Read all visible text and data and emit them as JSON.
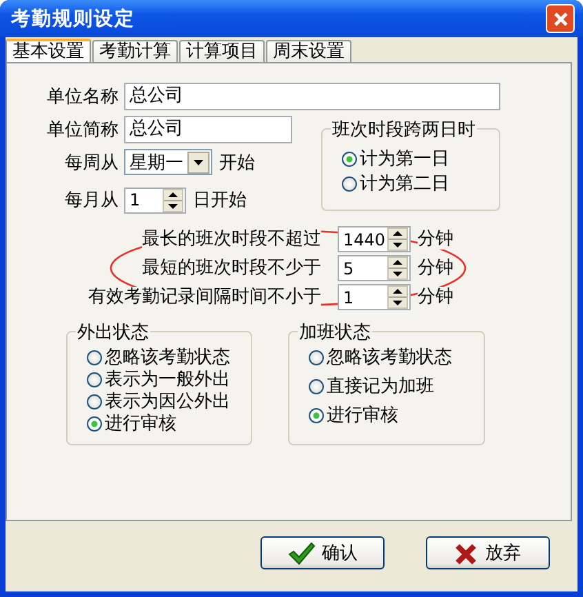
{
  "window": {
    "title": "考勤规则设定"
  },
  "tabs": [
    {
      "label": "基本设置",
      "selected": true
    },
    {
      "label": "考勤计算",
      "selected": false
    },
    {
      "label": "计算项目",
      "selected": false
    },
    {
      "label": "周末设置",
      "selected": false
    }
  ],
  "fields": [
    {
      "label": "单位名称",
      "value": "总公司"
    },
    {
      "label": "单位简称",
      "value": "总公司"
    }
  ],
  "week_start": {
    "label": "每周从",
    "value": "星期一",
    "suffix": "开始"
  },
  "month_start": {
    "label": "每月从",
    "value": "1",
    "suffix": "日开始"
  },
  "cross_day": {
    "title": "班次时段跨两日时",
    "options": [
      {
        "label": "计为第一日",
        "selected": true
      },
      {
        "label": "计为第二日",
        "selected": false
      }
    ]
  },
  "limits": [
    {
      "label": "最长的班次时段不超过",
      "value": "1440",
      "unit": "分钟",
      "circled": false
    },
    {
      "label": "最短的班次时段不少于",
      "value": "5",
      "unit": "分钟",
      "circled": true
    },
    {
      "label": "有效考勤记录间隔时间不小于",
      "value": "1",
      "unit": "分钟",
      "circled": false
    }
  ],
  "out_status": {
    "title": "外出状态",
    "options": [
      {
        "label": "忽略该考勤状态",
        "selected": false
      },
      {
        "label": "表示为一般外出",
        "selected": false
      },
      {
        "label": "表示为因公外出",
        "selected": false
      },
      {
        "label": "进行审核",
        "selected": true
      }
    ]
  },
  "overtime_status": {
    "title": "加班状态",
    "options": [
      {
        "label": "忽略该考勤状态",
        "selected": false
      },
      {
        "label": "直接记为加班",
        "selected": false
      },
      {
        "label": "进行审核",
        "selected": true
      }
    ]
  },
  "buttons": [
    {
      "label": "确认",
      "kind": "ok"
    },
    {
      "label": "放弃",
      "kind": "cancel"
    }
  ]
}
